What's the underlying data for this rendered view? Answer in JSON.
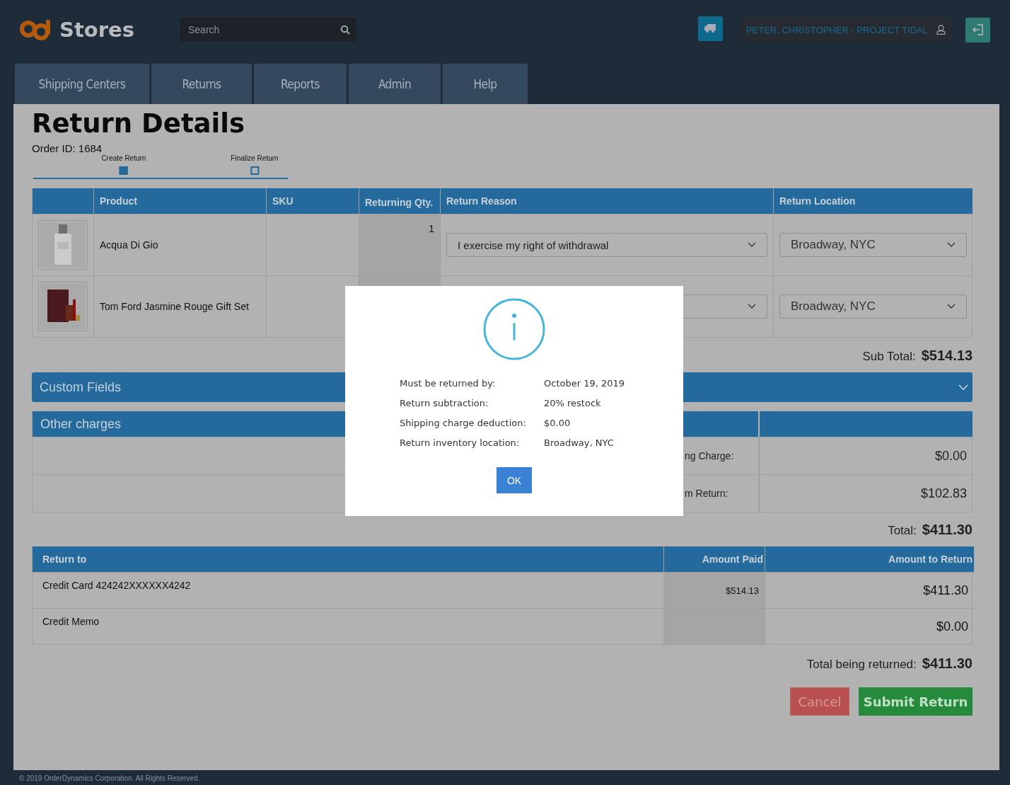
{
  "header": {
    "brand": "Stores",
    "search": {
      "placeholder": "Search"
    },
    "user": "PETER, CHRISTOPHER - PROJECT TIDAL"
  },
  "nav": [
    {
      "label": "Shipping Centers"
    },
    {
      "label": "Returns"
    },
    {
      "label": "Reports"
    },
    {
      "label": "Admin"
    },
    {
      "label": "Help"
    }
  ],
  "page": {
    "title": "Return Details",
    "order_id": "Order ID: 1684"
  },
  "steps": [
    {
      "label": "Create Return",
      "done": true
    },
    {
      "label": "Finalize Return",
      "done": false
    }
  ],
  "items_table": {
    "columns": [
      "Product",
      "SKU",
      "Returning Qty.",
      "Return Reason",
      "Return Location"
    ],
    "rows": [
      {
        "product": "Acqua Di Gio",
        "qty": "1",
        "reason": "I exercise my right of withdrawal",
        "location": "Broadway, NYC"
      },
      {
        "product": "Tom Ford Jasmine Rouge Gift Set",
        "location": "Broadway, NYC"
      }
    ]
  },
  "sub_total": {
    "label": "Sub Total:",
    "value": "$514.13"
  },
  "custom_fields": {
    "title": "Custom Fields"
  },
  "other_charges": {
    "title": "Other charges",
    "rows": [
      {
        "label": "ng Charge:",
        "value": "$0.00"
      },
      {
        "label": "m Return:",
        "value": "$102.83"
      }
    ]
  },
  "total": {
    "label": "Total:",
    "value": "$411.30"
  },
  "refund_table": {
    "columns": [
      "Return to",
      "Amount Paid",
      "Amount to Return"
    ],
    "rows": [
      {
        "method": "Credit Card 424242XXXXXX4242",
        "paid": "$514.13",
        "amount": "$411.30"
      },
      {
        "method": "Credit Memo",
        "amount": "$0.00"
      }
    ]
  },
  "grand_total": {
    "label": "Total being returned:",
    "value": "$411.30"
  },
  "buttons": {
    "cancel": "Cancel",
    "submit": "Submit Return"
  },
  "footer": "© 2019 OrderDynamics Corporation. All Rights Reserved.",
  "dialog": {
    "rows": [
      {
        "label": "Must be returned by:",
        "value": "October 19, 2019"
      },
      {
        "label": "Return subtraction:",
        "value": "20% restock"
      },
      {
        "label": "Shipping charge deduction:",
        "value": "$0.00"
      },
      {
        "label": "Return inventory location:",
        "value": "Broadway, NYC"
      }
    ],
    "ok": "OK"
  }
}
